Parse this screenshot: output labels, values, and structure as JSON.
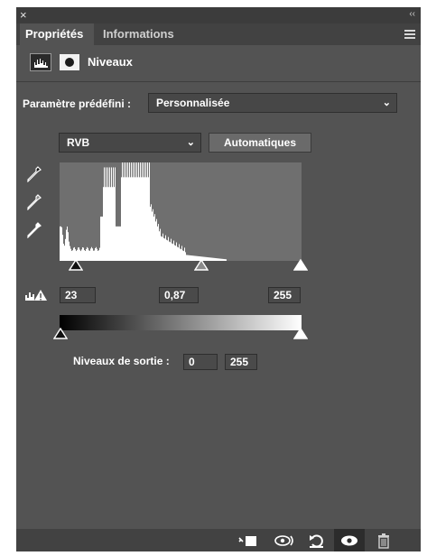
{
  "window": {
    "close_glyph": "×",
    "collapse_glyph": "‹‹"
  },
  "tabs": [
    {
      "label": "Propriétés",
      "active": true
    },
    {
      "label": "Informations",
      "active": false
    }
  ],
  "adjustment": {
    "title": "Niveaux",
    "icons": [
      "levels-histogram-icon",
      "mask-icon"
    ]
  },
  "preset": {
    "label": "Paramètre prédéfini :",
    "value": "Personnalisée"
  },
  "channel": {
    "value": "RVB"
  },
  "auto_button": {
    "label": "Automatiques"
  },
  "input_levels": {
    "black": "23",
    "gamma": "0,87",
    "white": "255"
  },
  "output_levels": {
    "label": "Niveaux de sortie :",
    "black": "0",
    "white": "255"
  },
  "colors": {
    "panel_bg": "#535353",
    "histogram_bg": "#6f6f6f",
    "histogram_fg": "#ffffff"
  },
  "bottom_toolbar": {
    "icons": [
      "clip-to-layer-icon",
      "view-previous-state-icon",
      "reset-icon",
      "visibility-eye-icon",
      "trash-icon"
    ]
  }
}
